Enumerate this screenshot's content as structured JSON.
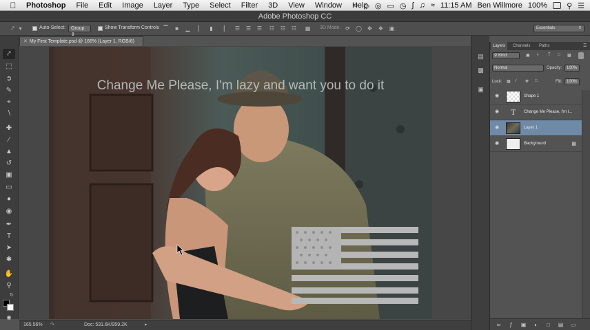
{
  "menubar": {
    "app": "Photoshop",
    "items": [
      "File",
      "Edit",
      "Image",
      "Layer",
      "Type",
      "Select",
      "Filter",
      "3D",
      "View",
      "Window",
      "Help"
    ],
    "clock": "11:15 AM",
    "user": "Ben Willmore",
    "battery": "100%"
  },
  "window": {
    "title": "Adobe Photoshop CC"
  },
  "options": {
    "auto_select_label": "Auto-Select:",
    "group_value": "Group",
    "transform_label": "Show Transform Controls",
    "mode_3d": "3D Mode:",
    "workspace": "Essentials"
  },
  "document": {
    "tab_title": "My First Template.psd @ 166% (Layer 1, RGB/8)",
    "overlay_text": "Change Me Please, I'm lazy and want you to do it",
    "zoom": "165.56%",
    "doc_info": "Doc: 531.6K/959.2K"
  },
  "layers_panel": {
    "tabs": [
      "Layers",
      "Channels",
      "Paths"
    ],
    "kind_label": "Kind",
    "blend_mode": "Normal",
    "opacity_label": "Opacity:",
    "opacity_value": "100%",
    "lock_label": "Lock:",
    "fill_label": "Fill:",
    "fill_value": "100%",
    "layers": [
      {
        "name": "Shape 1",
        "type": "shape",
        "selected": false
      },
      {
        "name": "Change Me Please, I'm l...",
        "type": "text",
        "selected": false
      },
      {
        "name": "Layer 1",
        "type": "image",
        "selected": true
      },
      {
        "name": "Background",
        "type": "background",
        "selected": false
      }
    ]
  },
  "colors": {
    "selected_layer": "#6f8aa6",
    "ui_dark": "#3d3d3d",
    "flag_gray": "#b8b8b8"
  }
}
